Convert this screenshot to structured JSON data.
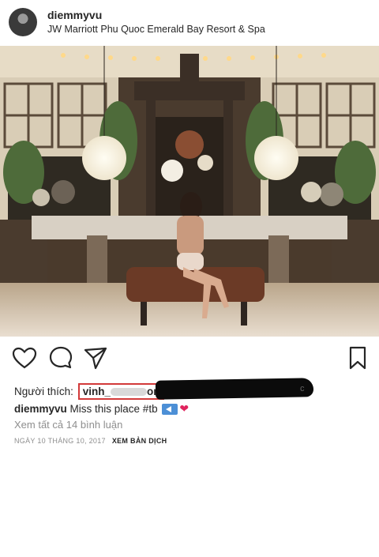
{
  "post": {
    "username": "diemmyvu",
    "location": "JW Marriott Phu Quoc Emerald Bay Resort & Spa",
    "likes_label": "Người thích:",
    "liker_visible": "vinh_",
    "liker_tail": "on",
    "redacted_tail": "c",
    "caption_user": "diemmyvu",
    "caption_text": " Miss this place #tb",
    "view_comments": "Xem tất cả 14 bình luận",
    "date": "NGÀY 10 THÁNG 10, 2017",
    "translate": "XEM BẢN DỊCH"
  },
  "icons": {
    "like": "heart-outline-icon",
    "comment": "comment-bubble-icon",
    "share": "paper-plane-icon",
    "save": "bookmark-icon",
    "back_emoji": "back-arrow-emoji",
    "heart_emoji": "red-heart-emoji"
  },
  "colors": {
    "highlight_box": "#d23a3a",
    "muted_text": "#8e8e8e",
    "heart": "#e0245e"
  }
}
